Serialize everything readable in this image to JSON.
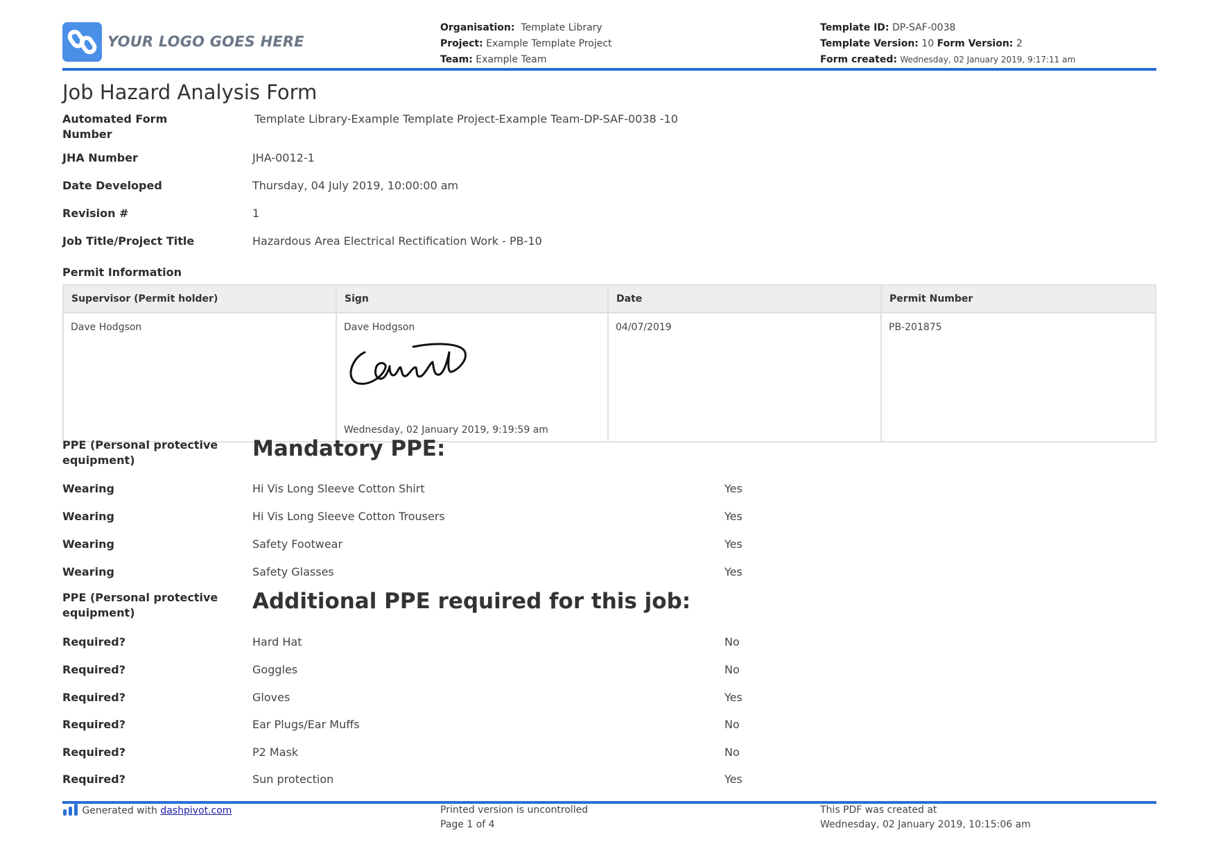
{
  "header": {
    "logo_text": "YOUR LOGO GOES HERE",
    "organisation_label": "Organisation:",
    "organisation": "Template Library",
    "project_label": "Project:",
    "project": "Example Template Project",
    "team_label": "Team:",
    "team": "Example Team",
    "template_id_label": "Template ID:",
    "template_id": "DP-SAF-0038",
    "template_version_label": "Template Version:",
    "template_version": "10",
    "form_version_label": "Form Version:",
    "form_version": "2",
    "form_created_label": "Form created:",
    "form_created": "Wednesday, 02 January 2019, 9:17:11 am",
    "accent_color": "#2a6fd6"
  },
  "form": {
    "title": "Job Hazard Analysis Form",
    "fields": [
      {
        "label": "Automated Form Number",
        "value": "Template Library-Example Template Project-Example Team-DP-SAF-0038   -10"
      },
      {
        "label": "JHA Number",
        "value": "JHA-0012-1"
      },
      {
        "label": "Date Developed",
        "value": "Thursday, 04 July 2019, 10:00:00 am"
      },
      {
        "label": "Revision #",
        "value": "1"
      },
      {
        "label": "Job Title/Project Title",
        "value": "Hazardous Area Electrical Rectification Work - PB-10"
      }
    ],
    "permit": {
      "section_label": "Permit Information",
      "headers": [
        "Supervisor (Permit holder)",
        "Sign",
        "Date",
        "Permit Number"
      ],
      "supervisor": "Dave Hodgson",
      "sign_name": "Dave Hodgson",
      "sign_date": "Wednesday, 02 January 2019, 9:19:59 am",
      "date": "04/07/2019",
      "permit_number": "PB-201875"
    },
    "mandatory_ppe": {
      "label": "PPE (Personal protective equipment)",
      "heading": "Mandatory PPE:",
      "items": [
        {
          "label": "Wearing",
          "item": "Hi Vis Long Sleeve Cotton Shirt",
          "answer": "Yes"
        },
        {
          "label": "Wearing",
          "item": "Hi Vis Long Sleeve Cotton Trousers",
          "answer": "Yes"
        },
        {
          "label": "Wearing",
          "item": "Safety Footwear",
          "answer": "Yes"
        },
        {
          "label": "Wearing",
          "item": "Safety Glasses",
          "answer": "Yes"
        }
      ]
    },
    "additional_ppe": {
      "label": "PPE (Personal protective equipment)",
      "heading": "Additional PPE required for this job:",
      "items": [
        {
          "label": "Required?",
          "item": "Hard Hat",
          "answer": "No"
        },
        {
          "label": "Required?",
          "item": "Goggles",
          "answer": "No"
        },
        {
          "label": "Required?",
          "item": "Gloves",
          "answer": "Yes"
        },
        {
          "label": "Required?",
          "item": "Ear Plugs/Ear Muffs",
          "answer": "No"
        },
        {
          "label": "Required?",
          "item": "P2 Mask",
          "answer": "No"
        },
        {
          "label": "Required?",
          "item": "Sun protection",
          "answer": "Yes"
        }
      ]
    }
  },
  "footer": {
    "generated_prefix": "Generated with",
    "generated_link": "dashpivot.com",
    "uncontrolled": "Printed version is uncontrolled",
    "page": "Page 1 of 4",
    "pdf_created_label": "This PDF was created at",
    "pdf_created": "Wednesday, 02 January 2019, 10:15:06 am"
  }
}
